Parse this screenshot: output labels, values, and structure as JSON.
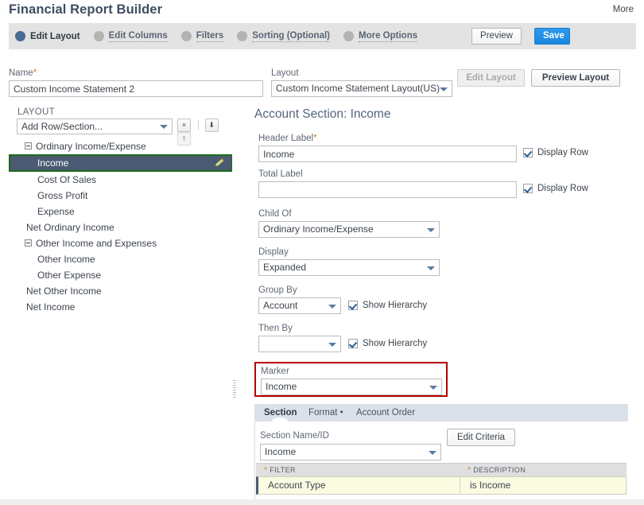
{
  "header": {
    "title": "Financial Report Builder",
    "more_label": "More"
  },
  "steps": [
    {
      "label": "Edit Layout",
      "active": true
    },
    {
      "label": "Edit Columns",
      "active": false
    },
    {
      "label": "Filters",
      "active": false
    },
    {
      "label": "Sorting (Optional)",
      "active": false
    },
    {
      "label": "More Options",
      "active": false
    }
  ],
  "actions": {
    "preview_label": "Preview",
    "save_label": "Save"
  },
  "name_field": {
    "label": "Name",
    "required_marker": "*",
    "value": "Custom Income Statement 2"
  },
  "layout_field": {
    "label": "Layout",
    "value": "Custom Income Statement Layout(US)",
    "edit_layout_label": "Edit Layout",
    "preview_layout_label": "Preview Layout"
  },
  "tree_panel": {
    "caption": "LAYOUT",
    "add_row_value": "Add Row/Section...",
    "buttons": {
      "delete_label": "×",
      "move_down_label": "⬇",
      "move_up_label": "⬆"
    },
    "nodes": [
      {
        "label": "Ordinary Income/Expense",
        "level": 0,
        "expander": true,
        "selected": false
      },
      {
        "label": "Income",
        "level": 1,
        "expander": false,
        "selected": true
      },
      {
        "label": "Cost Of Sales",
        "level": 1,
        "expander": false,
        "selected": false
      },
      {
        "label": "Gross Profit",
        "level": 1,
        "expander": false,
        "selected": false
      },
      {
        "label": "Expense",
        "level": 1,
        "expander": false,
        "selected": false
      },
      {
        "label": "Net Ordinary Income",
        "level": 0,
        "expander": false,
        "selected": false
      },
      {
        "label": "Other Income and Expenses",
        "level": 0,
        "expander": true,
        "selected": false
      },
      {
        "label": "Other Income",
        "level": 1,
        "expander": false,
        "selected": false
      },
      {
        "label": "Other Expense",
        "level": 1,
        "expander": false,
        "selected": false
      },
      {
        "label": "Net Other Income",
        "level": 0,
        "expander": false,
        "selected": false
      },
      {
        "label": "Net Income",
        "level": 0,
        "expander": false,
        "selected": false
      }
    ]
  },
  "form": {
    "section_title": "Account Section: Income",
    "header_label": {
      "label": "Header Label",
      "required_marker": "*",
      "value": "Income"
    },
    "header_display_row": {
      "label": "Display Row",
      "checked": true
    },
    "total_label": {
      "label": "Total Label",
      "value": ""
    },
    "total_display_row": {
      "label": "Display Row",
      "checked": true
    },
    "child_of": {
      "label": "Child Of",
      "value": "Ordinary Income/Expense"
    },
    "display": {
      "label": "Display",
      "value": "Expanded"
    },
    "group_by": {
      "label": "Group By",
      "value": "Account"
    },
    "group_by_hierarchy": {
      "label": "Show Hierarchy",
      "checked": true
    },
    "then_by": {
      "label": "Then By",
      "value": ""
    },
    "then_by_hierarchy": {
      "label": "Show Hierarchy",
      "checked": true
    },
    "marker": {
      "label": "Marker",
      "value": "Income",
      "highlight_color": "#b50000"
    }
  },
  "tabs": [
    {
      "label": "Section",
      "active": true,
      "dot": false
    },
    {
      "label": "Format",
      "active": false,
      "dot": true
    },
    {
      "label": "Account Order",
      "active": false,
      "dot": false
    }
  ],
  "section_tab": {
    "name_id_label": "Section Name/ID",
    "name_id_value": "Income",
    "edit_criteria_label": "Edit Criteria"
  },
  "criteria_table": {
    "columns": [
      {
        "label": "FILTER",
        "required": true
      },
      {
        "label": "DESCRIPTION",
        "required": true
      }
    ],
    "rows": [
      {
        "filter": "Account Type",
        "description": "is Income"
      }
    ]
  }
}
